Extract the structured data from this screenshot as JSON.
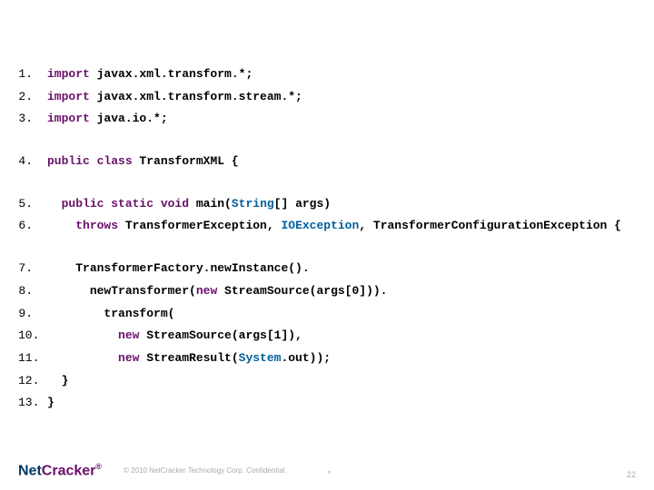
{
  "lines": [
    {
      "n": "1.",
      "indent": "",
      "tokens": [
        {
          "t": "import",
          "c": "kw"
        },
        {
          "t": " javax.xml.transform.*;",
          "c": "plain"
        }
      ]
    },
    {
      "n": "2.",
      "indent": "",
      "tokens": [
        {
          "t": "import",
          "c": "kw"
        },
        {
          "t": " javax.xml.transform.stream.*;",
          "c": "plain"
        }
      ]
    },
    {
      "n": "3.",
      "indent": "",
      "tokens": [
        {
          "t": "import",
          "c": "kw"
        },
        {
          "t": " java.io.*;",
          "c": "plain"
        }
      ]
    },
    {
      "blank": true
    },
    {
      "n": "4.",
      "indent": "",
      "tokens": [
        {
          "t": "public class",
          "c": "kw"
        },
        {
          "t": " TransformXML {",
          "c": "plain"
        }
      ]
    },
    {
      "blank": true
    },
    {
      "n": "5.",
      "indent": "  ",
      "tokens": [
        {
          "t": "public static void",
          "c": "kw"
        },
        {
          "t": " main(",
          "c": "plain"
        },
        {
          "t": "String",
          "c": "cls"
        },
        {
          "t": "[] args)",
          "c": "plain"
        }
      ]
    },
    {
      "n": "6.",
      "indent": "    ",
      "tokens": [
        {
          "t": "throws",
          "c": "kw"
        },
        {
          "t": " TransformerException, ",
          "c": "plain"
        },
        {
          "t": "IOException",
          "c": "cls"
        },
        {
          "t": ", TransformerConfigurationException {",
          "c": "plain"
        }
      ]
    },
    {
      "blank": true
    },
    {
      "n": "7.",
      "indent": "    ",
      "tokens": [
        {
          "t": "TransformerFactory.newInstance().",
          "c": "plain"
        }
      ]
    },
    {
      "n": "8.",
      "indent": "      ",
      "tokens": [
        {
          "t": "newTransformer(",
          "c": "plain"
        },
        {
          "t": "new",
          "c": "kw"
        },
        {
          "t": " StreamSource(args[0])).",
          "c": "plain"
        }
      ]
    },
    {
      "n": "9.",
      "indent": "        ",
      "tokens": [
        {
          "t": "transform(",
          "c": "plain"
        }
      ]
    },
    {
      "n": "10.",
      "indent": "          ",
      "tokens": [
        {
          "t": "new",
          "c": "kw"
        },
        {
          "t": " StreamSource(args[1]),",
          "c": "plain"
        }
      ]
    },
    {
      "n": "11.",
      "indent": "          ",
      "tokens": [
        {
          "t": "new",
          "c": "kw"
        },
        {
          "t": " StreamResult(",
          "c": "plain"
        },
        {
          "t": "System",
          "c": "cls"
        },
        {
          "t": ".out));",
          "c": "plain"
        }
      ]
    },
    {
      "n": "12.",
      "indent": "  ",
      "tokens": [
        {
          "t": "}",
          "c": "plain"
        }
      ]
    },
    {
      "n": "13.",
      "indent": "",
      "tokens": [
        {
          "t": "}",
          "c": "plain"
        }
      ]
    }
  ],
  "footer": {
    "logo_net": "Net",
    "logo_cracker": "Cracker",
    "logo_r": "®",
    "copyright": "© 2010 NetCracker Technology Corp. Confidential.",
    "asterisk": "*",
    "page": "22"
  }
}
